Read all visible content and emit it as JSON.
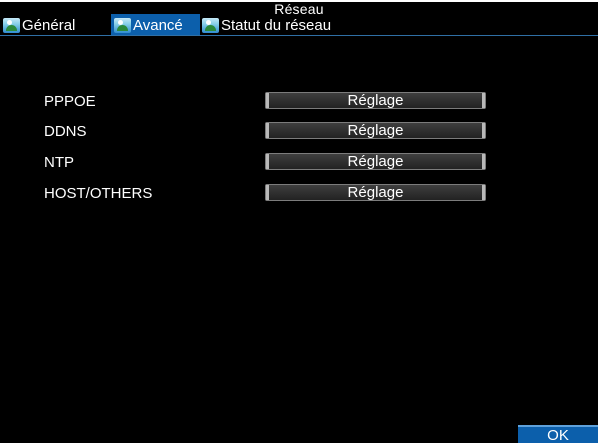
{
  "window": {
    "title": "Réseau"
  },
  "tabs": [
    {
      "label": "Général",
      "icon": "network-icon"
    },
    {
      "label": "Avancé",
      "icon": "network-icon",
      "active": true
    },
    {
      "label": "Statut du réseau",
      "icon": "network-icon"
    }
  ],
  "settings": [
    {
      "label": "PPPOE",
      "button": "Réglage"
    },
    {
      "label": "DDNS",
      "button": "Réglage"
    },
    {
      "label": "NTP",
      "button": "Réglage"
    },
    {
      "label": "HOST/OTHERS",
      "button": "Réglage"
    }
  ],
  "footer": {
    "ok": "OK"
  },
  "colors": {
    "accent": "#0c5fab",
    "background": "#000000",
    "text": "#ffffff"
  }
}
